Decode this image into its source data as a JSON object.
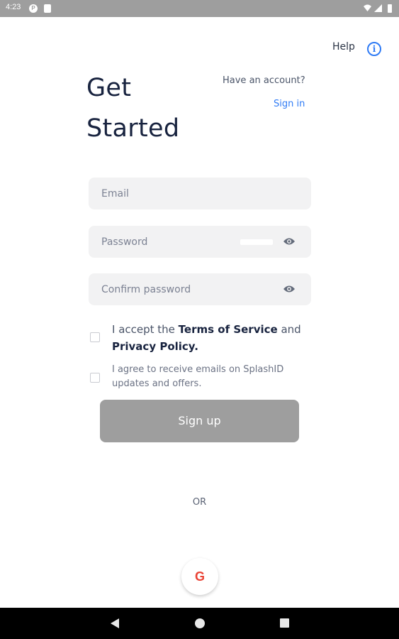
{
  "status_bar": {
    "time": "4:23",
    "notification_letter": "P",
    "icons": [
      "wifi-icon",
      "signal-icon",
      "battery-icon"
    ]
  },
  "header": {
    "help_label": "Help",
    "help_icon": "info-icon",
    "title_line1": "Get",
    "title_line2": "Started",
    "have_account": "Have an account?",
    "sign_in": "Sign in"
  },
  "form": {
    "email_placeholder": "Email",
    "email_value": "",
    "password_placeholder": "Password",
    "password_value": "",
    "confirm_placeholder": "Confirm password",
    "confirm_value": "",
    "eye_icon": "eye-icon"
  },
  "terms": {
    "prefix": "I accept the ",
    "terms_link": "Terms of Service",
    "middle": " and ",
    "privacy_link": "Privacy Policy.",
    "checked": false
  },
  "emails_opt_in": {
    "label": "I agree to receive emails on SplashID updates and offers.",
    "checked": false
  },
  "signup_button": "Sign up",
  "or_label": "OR",
  "google": {
    "icon": "google-icon",
    "letter": "G"
  },
  "nav_bar": {
    "icons": [
      "back-icon",
      "home-icon",
      "recents-icon"
    ]
  },
  "colors": {
    "accent": "#2f7bf5",
    "title": "#18233f",
    "field_bg": "#f2f2f3",
    "button_disabled": "#9e9e9e",
    "google_red": "#ea4335"
  }
}
